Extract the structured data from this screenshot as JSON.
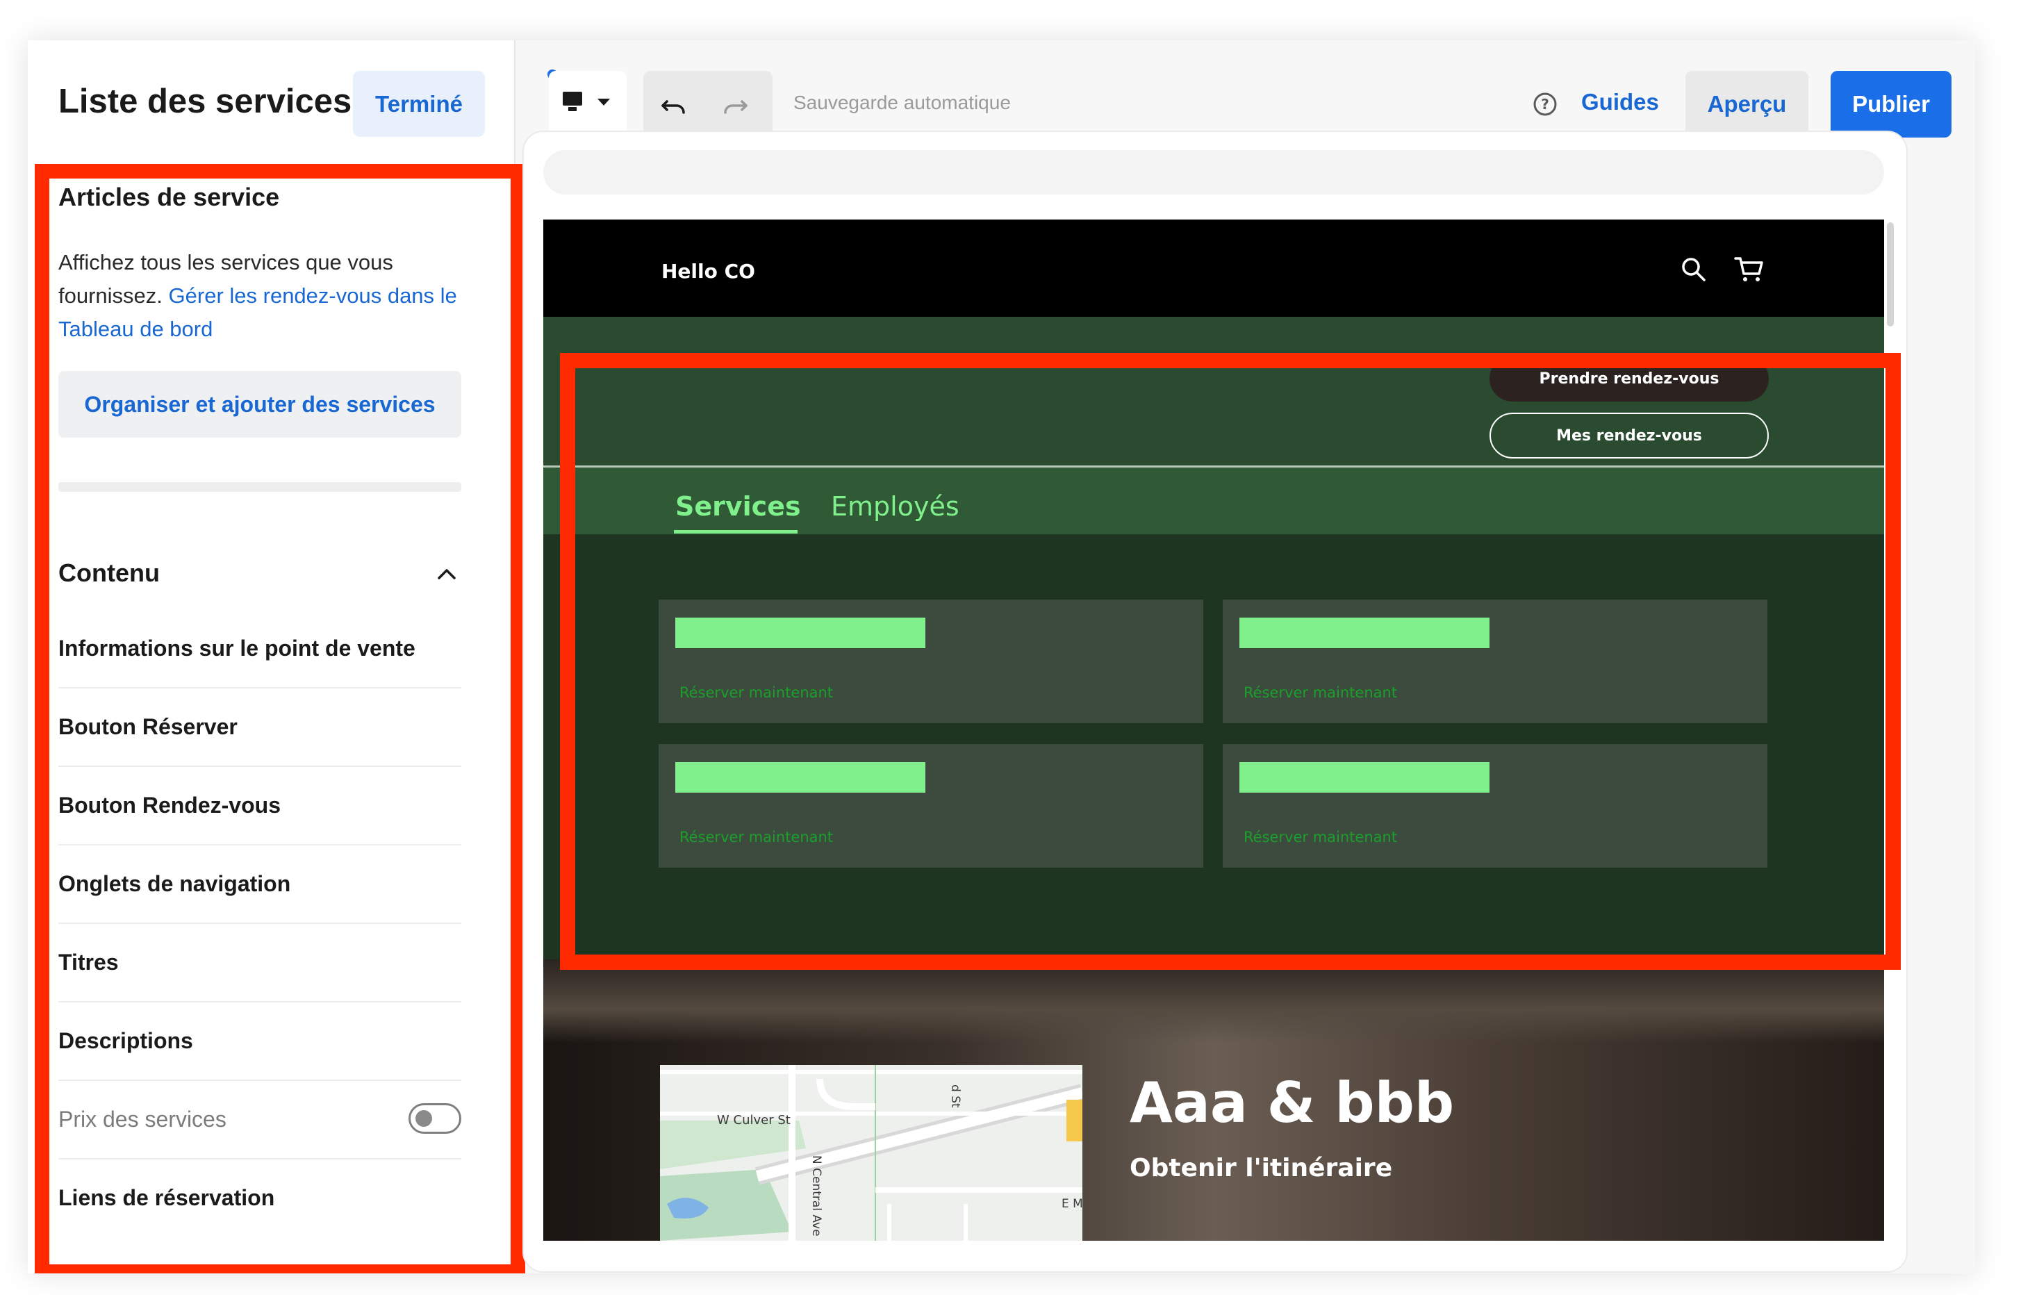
{
  "sidebar": {
    "title": "Liste des services",
    "done_label": "Terminé",
    "section_title": "Articles de service",
    "description": "Affichez tous les services que vous fournissez.",
    "description_link": "Gérer les rendez-vous dans le Tableau de bord",
    "organize_button": "Organiser et ajouter des services",
    "content_title": "Contenu",
    "items": [
      {
        "label": "Informations sur le point de vente"
      },
      {
        "label": "Bouton Réserver"
      },
      {
        "label": "Bouton Rendez-vous"
      },
      {
        "label": "Onglets de navigation"
      },
      {
        "label": "Titres"
      },
      {
        "label": "Descriptions"
      },
      {
        "label": "Prix des services",
        "toggle": "off"
      },
      {
        "label": "Liens de réservation"
      }
    ]
  },
  "toolbar": {
    "autosave": "Sauvegarde automatique",
    "guides": "Guides",
    "preview": "Aperçu",
    "publish": "Publier"
  },
  "site": {
    "brand": "Hello CO",
    "appointment_button": "Prendre rendez-vous",
    "my_appointments_button": "Mes rendez-vous",
    "tabs": [
      {
        "label": "Services",
        "active": true
      },
      {
        "label": "Employés",
        "active": false
      }
    ],
    "services": [
      {
        "link": "Réserver maintenant"
      },
      {
        "link": "Réserver maintenant"
      },
      {
        "link": "Réserver maintenant"
      },
      {
        "link": "Réserver maintenant"
      }
    ],
    "location_title": "Aaa & bbb",
    "directions_link": "Obtenir l'itinéraire",
    "map_labels": {
      "street1": "W Culver St",
      "street2": "N Central Ave",
      "street3": "d St",
      "street4": "E M"
    }
  },
  "colors": {
    "accent": "#1a6fe8",
    "highlight": "#ff2a00",
    "site_green": "#2a4b30",
    "site_mint": "#7ff08c"
  }
}
